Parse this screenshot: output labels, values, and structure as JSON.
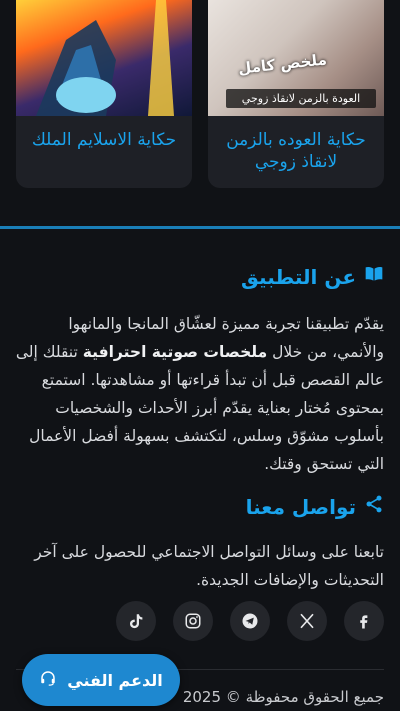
{
  "cards": [
    {
      "title": "حكاية العوده بالزمن لانقاذ زوجي",
      "cover_overlay": "العودة بالزمن لانقاذ زوجي",
      "cover_stamp": "ملخص كامل"
    },
    {
      "title": "حكاية الاسلايم الملك"
    }
  ],
  "about": {
    "heading": "عن التطبيق",
    "text_before": "يقدّم تطبيقنا تجربة مميزة لعشّاق المانجا والمانهوا والأنمي، من خلال ",
    "text_bold": "ملخصات صوتية احترافية",
    "text_after": " تنقلك إلى عالم القصص قبل أن تبدأ قراءتها أو مشاهدتها. استمتع بمحتوى مُختار بعناية يقدّم أبرز الأحداث والشخصيات بأسلوب مشوّق وسلس، لتكتشف بسهولة أفضل الأعمال التي تستحق وقتك."
  },
  "contact": {
    "heading": "تواصل معنا",
    "text": "تابعنا على وسائل التواصل الاجتماعي للحصول على آخر التحديثات والإضافات الجديدة."
  },
  "socials": [
    "facebook-icon",
    "x-icon",
    "telegram-icon",
    "instagram-icon",
    "tiktok-icon"
  ],
  "footer": {
    "copyright": "جميع الحقوق محفوظة © 2025"
  },
  "support_button": {
    "label": "الدعم الفني"
  },
  "colors": {
    "accent": "#1aa3ec",
    "background": "#101216",
    "card": "#1e2026"
  }
}
